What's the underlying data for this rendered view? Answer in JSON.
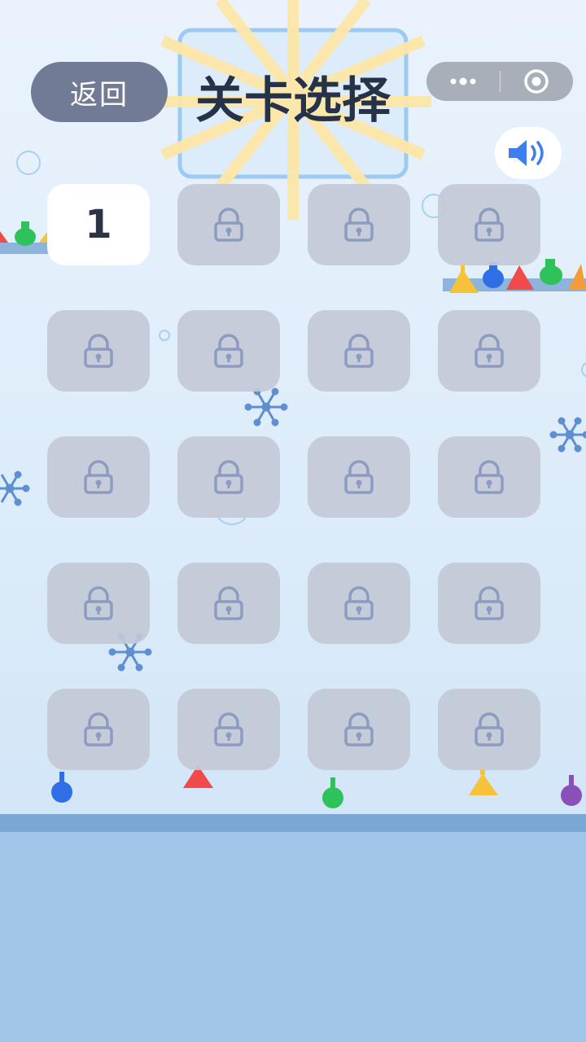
{
  "header": {
    "back_label": "返回",
    "title": "关卡选择",
    "capsule_icons": [
      "more-dots-icon",
      "close-target-icon"
    ],
    "sound_icon": "speaker-icon"
  },
  "levels": [
    {
      "label": "1",
      "locked": false
    },
    {
      "label": "",
      "locked": true
    },
    {
      "label": "",
      "locked": true
    },
    {
      "label": "",
      "locked": true
    },
    {
      "label": "",
      "locked": true
    },
    {
      "label": "",
      "locked": true
    },
    {
      "label": "",
      "locked": true
    },
    {
      "label": "",
      "locked": true
    },
    {
      "label": "",
      "locked": true
    },
    {
      "label": "",
      "locked": true
    },
    {
      "label": "",
      "locked": true
    },
    {
      "label": "",
      "locked": true
    },
    {
      "label": "",
      "locked": true
    },
    {
      "label": "",
      "locked": true
    },
    {
      "label": "",
      "locked": true
    },
    {
      "label": "",
      "locked": true
    },
    {
      "label": "",
      "locked": true
    },
    {
      "label": "",
      "locked": true
    },
    {
      "label": "",
      "locked": true
    },
    {
      "label": "",
      "locked": true
    }
  ],
  "colors": {
    "flask_red": "#f04a4a",
    "flask_green": "#2ec25a",
    "flask_blue": "#2f6fe6",
    "flask_yellow": "#f6c23a",
    "flask_orange": "#f79a38",
    "flask_purple": "#8a4fb8",
    "sun_ray": "#fde7a8",
    "lock": "#8d9bc0",
    "accent_blue": "#3d7ef0"
  }
}
